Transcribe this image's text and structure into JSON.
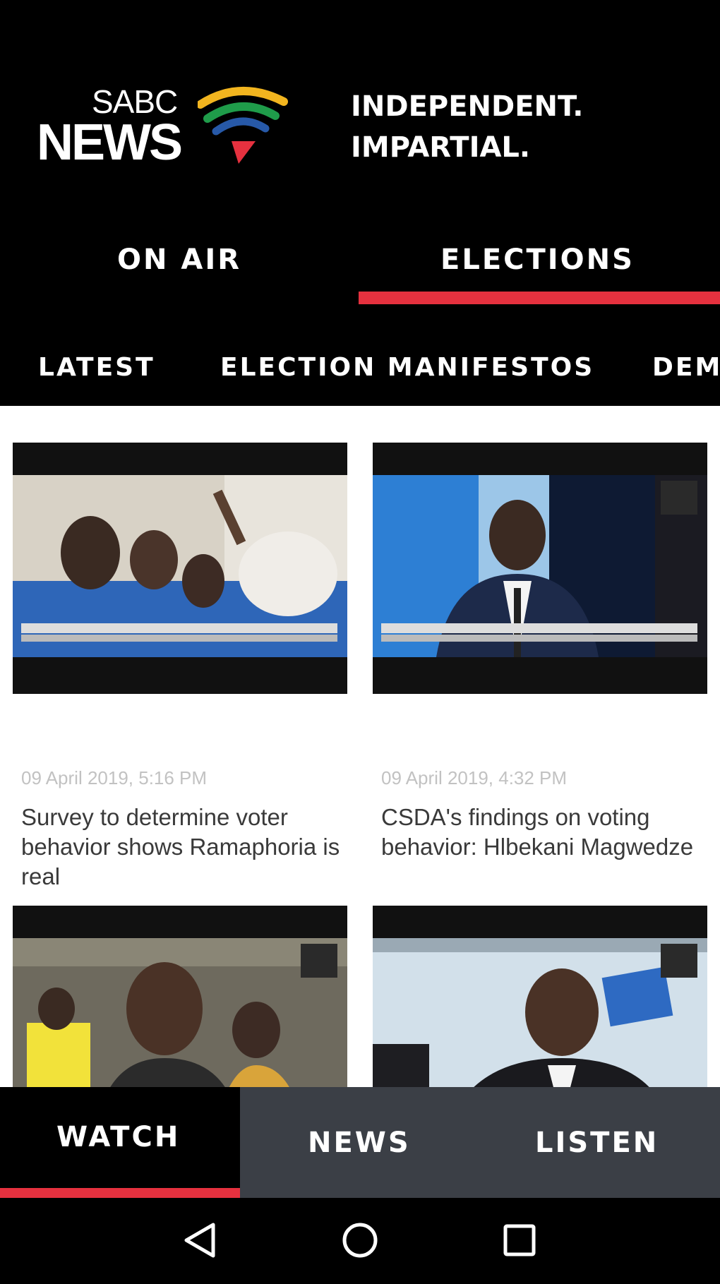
{
  "brand": {
    "logo_top": "SABC",
    "logo_bottom": "NEWS",
    "tagline_line1": "INDEPENDENT.",
    "tagline_line2": "IMPARTIAL.",
    "colors": {
      "accent": "#e5313f",
      "background": "#000000",
      "bottom_nav": "#3b3f46"
    }
  },
  "top_tabs": [
    {
      "label": "ON AIR",
      "selected": false
    },
    {
      "label": "ELECTIONS",
      "selected": true
    }
  ],
  "sub_tabs": [
    {
      "label": "LATEST"
    },
    {
      "label": "ELECTION MANIFESTOS"
    },
    {
      "label": "DEM"
    }
  ],
  "articles": [
    {
      "date": "09 April 2019, 5:16 PM",
      "title": "Survey to determine voter behavior shows Ramaphoria is real"
    },
    {
      "date": "09 April 2019, 4:32 PM",
      "title": "CSDA's findings on voting behavior: Hlbekani Magwedze"
    },
    {
      "date": "",
      "title": ""
    },
    {
      "date": "",
      "title": ""
    }
  ],
  "bottom_nav": [
    {
      "label": "WATCH",
      "selected": true
    },
    {
      "label": "NEWS",
      "selected": false
    },
    {
      "label": "LISTEN",
      "selected": false
    }
  ],
  "system_nav": {
    "back_icon": "triangle-back-icon",
    "home_icon": "circle-home-icon",
    "recents_icon": "square-recents-icon"
  }
}
